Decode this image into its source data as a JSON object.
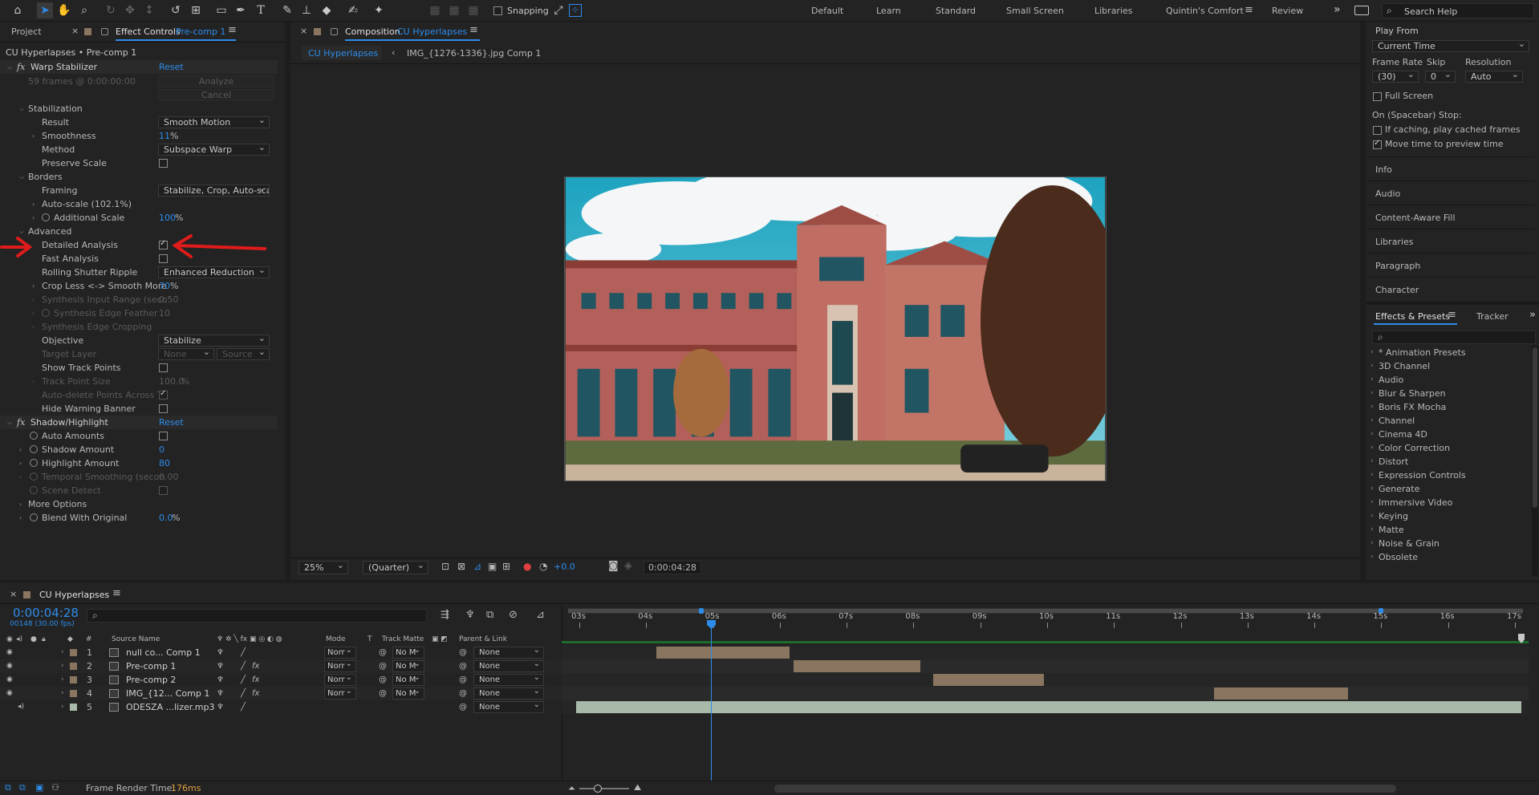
{
  "toolbar": {
    "snapping": "Snapping",
    "workspaces": [
      "Default",
      "Learn",
      "Standard",
      "Small Screen",
      "Libraries",
      "Quintin's Comfort",
      "Review"
    ],
    "active_workspace": "Quintin's Comfort",
    "search_help": "Search Help"
  },
  "left_panel": {
    "tabs": {
      "project": "Project",
      "effect_controls": "Effect Controls",
      "effect_controls_target": "Pre-comp 1"
    },
    "breadcrumb": "CU Hyperlapses • Pre-comp 1",
    "warp": {
      "name": "Warp Stabilizer",
      "reset": "Reset",
      "frames_info": "59 frames @ 0:00:00:00",
      "analyze": "Analyze",
      "cancel": "Cancel",
      "stabilization": "Stabilization",
      "result_label": "Result",
      "result_value": "Smooth Motion",
      "smoothness_label": "Smoothness",
      "smoothness_value": "11",
      "method_label": "Method",
      "method_value": "Subspace Warp",
      "preserve_scale": "Preserve Scale",
      "borders": "Borders",
      "framing_label": "Framing",
      "framing_value": "Stabilize, Crop, Auto-scale",
      "autoscale": "Auto-scale (102.1%)",
      "additional_scale_label": "Additional Scale",
      "additional_scale_value": "100",
      "advanced": "Advanced",
      "detailed_analysis": "Detailed Analysis",
      "fast_analysis": "Fast Analysis",
      "rolling_shutter_label": "Rolling Shutter Ripple",
      "rolling_shutter_value": "Enhanced Reduction",
      "crop_less_label": "Crop Less <-> Smooth More",
      "crop_less_value": "70",
      "synth_input_label": "Synthesis Input Range (seco",
      "synth_input_value": "0.50",
      "synth_feather_label": "Synthesis Edge Feather",
      "synth_feather_value": "10",
      "synth_crop_label": "Synthesis Edge Cropping",
      "objective_label": "Objective",
      "objective_value": "Stabilize",
      "target_layer_label": "Target Layer",
      "target_layer_value": "None",
      "target_source_value": "Source",
      "show_track_points": "Show Track Points",
      "track_point_size_label": "Track Point Size",
      "track_point_size_value": "100.0",
      "auto_delete_label": "Auto-delete Points Across Ti",
      "hide_warning": "Hide Warning Banner"
    },
    "shadow": {
      "name": "Shadow/Highlight",
      "reset": "Reset",
      "auto_amounts": "Auto Amounts",
      "shadow_amount_label": "Shadow Amount",
      "shadow_amount_value": "0",
      "highlight_amount_label": "Highlight Amount",
      "highlight_amount_value": "80",
      "temporal_label": "Temporal Smoothing (secon",
      "temporal_value": "0.00",
      "scene_detect": "Scene Detect",
      "more_options": "More Options",
      "blend_label": "Blend With Original",
      "blend_value": "0.0"
    }
  },
  "composition": {
    "tab_prefix": "Composition",
    "tab_name": "CU Hyperlapses",
    "breadcrumb_1": "CU Hyperlapses",
    "breadcrumb_2": "IMG_{1276-1336}.jpg Comp 1",
    "zoom": "25%",
    "resolution": "(Quarter)",
    "exposure": "+0.0",
    "timecode": "0:00:04:28"
  },
  "right_panel": {
    "play_from_label": "Play From",
    "play_from_value": "Current Time",
    "frame_rate_label": "Frame Rate",
    "skip_label": "Skip",
    "resolution_label": "Resolution",
    "frame_rate_value": "(30)",
    "skip_value": "0",
    "resolution_value": "Auto",
    "full_screen": "Full Screen",
    "on_stop": "On (Spacebar) Stop:",
    "if_caching": "If caching, play cached frames",
    "move_time": "Move time to preview time",
    "panels": [
      "Info",
      "Audio",
      "Content-Aware Fill",
      "Libraries",
      "Paragraph",
      "Character"
    ],
    "effects_tab": "Effects & Presets",
    "tracker_tab": "Tracker",
    "effects_list": [
      "* Animation Presets",
      "3D Channel",
      "Audio",
      "Blur & Sharpen",
      "Boris FX Mocha",
      "Channel",
      "Cinema 4D",
      "Color Correction",
      "Distort",
      "Expression Controls",
      "Generate",
      "Immersive Video",
      "Keying",
      "Matte",
      "Noise & Grain",
      "Obsolete"
    ]
  },
  "timeline": {
    "comp_name": "CU Hyperlapses",
    "timecode": "0:00:04:28",
    "frame_info": "00148 (30.00 fps)",
    "columns": {
      "num": "#",
      "source": "Source Name",
      "mode": "Mode",
      "t": "T",
      "track_matte": "Track Matte",
      "parent": "Parent & Link"
    },
    "ticks": [
      "03s",
      "04s",
      "05s",
      "06s",
      "07s",
      "08s",
      "09s",
      "10s",
      "11s",
      "12s",
      "13s",
      "14s",
      "15s",
      "16s",
      "17s"
    ],
    "layers": [
      {
        "num": "1",
        "name": "null co... Comp 1",
        "mode": "Norr",
        "matte": "No M",
        "parent": "None",
        "color": "#8a7560"
      },
      {
        "num": "2",
        "name": "Pre-comp 1",
        "mode": "Norr",
        "matte": "No M",
        "parent": "None",
        "color": "#8a7560"
      },
      {
        "num": "3",
        "name": "Pre-comp 2",
        "mode": "Norr",
        "matte": "No M",
        "parent": "None",
        "color": "#8a7560"
      },
      {
        "num": "4",
        "name": "IMG_{12... Comp 1",
        "mode": "Norr",
        "matte": "No M",
        "parent": "None",
        "color": "#8a7560"
      },
      {
        "num": "5",
        "name": "ODESZA ...lizer.mp3",
        "mode": "",
        "matte": "",
        "parent": "None",
        "color": "#a9b9a9"
      }
    ],
    "clips_seconds": [
      {
        "start": 4.15,
        "end": 6.15
      },
      {
        "start": 6.2,
        "end": 8.1
      },
      {
        "start": 8.3,
        "end": 9.95
      },
      {
        "start": 12.5,
        "end": 14.5
      },
      {
        "start": 2.95,
        "end": 17.1
      }
    ],
    "playhead_seconds": 4.97
  },
  "status": {
    "frame_render_label": "Frame Render Time:",
    "frame_render_value": "176ms"
  },
  "colors": {
    "accent": "#2d8ceb",
    "annotation": "#e01b1b",
    "panel": "#232323"
  }
}
